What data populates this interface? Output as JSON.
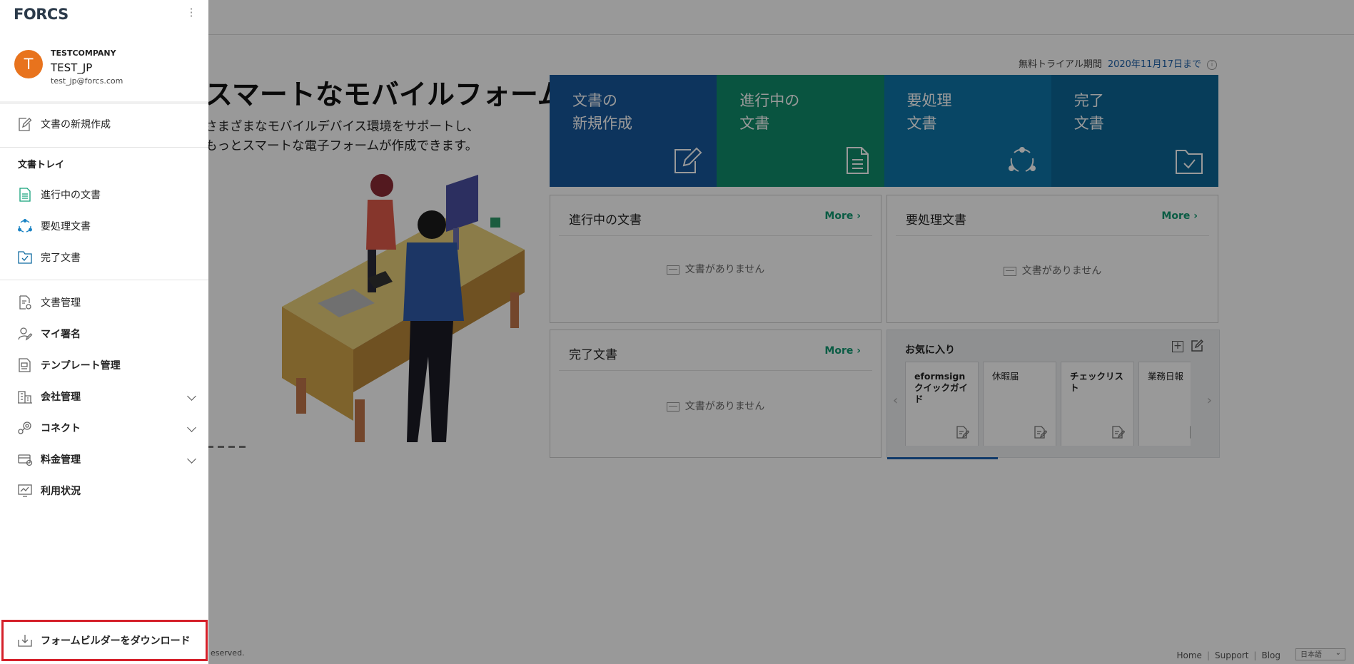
{
  "main": {
    "trial": {
      "label": "無料トライアル期間",
      "date": "2020年11月17日まで",
      "info_icon": "info-icon"
    },
    "hero": {
      "title": "スマートなモバイルフォーム",
      "subtitle_line1": "さまざまなモバイルデバイス環境をサポートし、",
      "subtitle_line2": "もっとスマートな電子フォームが作成できます。"
    },
    "tiles": [
      {
        "label": "文書の\n新規作成",
        "icon": "edit-icon",
        "color": "#17589c"
      },
      {
        "label": "進行中の\n文書",
        "icon": "document-icon",
        "color": "#0f8d6c"
      },
      {
        "label": "要処理\n文書",
        "icon": "cycle-icon",
        "color": "#0e76a8"
      },
      {
        "label": "完了\n文書",
        "icon": "folder-check-icon",
        "color": "#0c6797"
      }
    ],
    "cards": {
      "in_progress": {
        "title": "進行中の文書",
        "more": "More",
        "empty": "文書がありません"
      },
      "action_required": {
        "title": "要処理文書",
        "more": "More",
        "empty": "文書がありません"
      },
      "completed": {
        "title": "完了文書",
        "more": "More",
        "empty": "文書がありません"
      }
    },
    "favorites": {
      "title": "お気に入り",
      "items": [
        "eformsignクイックガイド",
        "休暇届",
        "チェックリスト",
        "業務日報"
      ]
    },
    "footer": {
      "copyright_fragment": "eserved.",
      "links": [
        "Home",
        "Support",
        "Blog"
      ],
      "language": "日本語"
    }
  },
  "drawer": {
    "logo": "FORCS",
    "company": "TESTCOMPANY",
    "user_name": "TEST_JP",
    "email": "test_jp@forcs.com",
    "avatar_initial": "T",
    "avatar_color": "#e8731d",
    "new_document": "文書の新規作成",
    "tray_section": "文書トレイ",
    "tray": [
      "進行中の文書",
      "要処理文書",
      "完了文書"
    ],
    "menu": [
      "文書管理",
      "マイ署名",
      "テンプレート管理",
      "会社管理",
      "コネクト",
      "料金管理",
      "利用状況"
    ],
    "download": "フォームビルダーをダウンロード"
  }
}
